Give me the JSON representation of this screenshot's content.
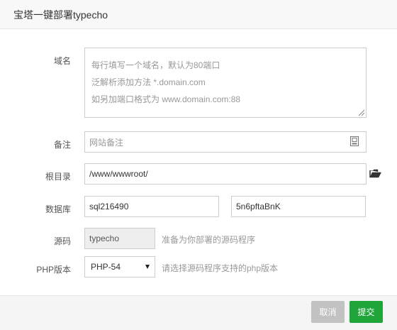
{
  "header": {
    "title": "宝塔一键部署typecho"
  },
  "form": {
    "domain": {
      "label": "域名",
      "placeholder_lines": [
        "每行填写一个域名，默认为80端口",
        "泛解析添加方法 *.domain.com",
        "如另加端口格式为 www.domain.com:88"
      ]
    },
    "note": {
      "label": "备注",
      "placeholder": "网站备注"
    },
    "root_dir": {
      "label": "根目录",
      "value": "/www/wwwroot/"
    },
    "database": {
      "label": "数据库",
      "user": "sql216490",
      "password": "5n6pftaBnK"
    },
    "source": {
      "label": "源码",
      "value": "typecho",
      "hint": "准备为你部署的源码程序"
    },
    "php_version": {
      "label": "PHP版本",
      "selected": "PHP-54",
      "hint": "请选择源码程序支持的php版本"
    }
  },
  "footer": {
    "cancel_label": "取消",
    "submit_label": "提交"
  },
  "colors": {
    "submit": "#20a53a",
    "cancel": "#c2c2c2"
  },
  "icons": {
    "note": "note-icon",
    "folder": "folder-open-icon",
    "select": "caret-down-icon"
  }
}
